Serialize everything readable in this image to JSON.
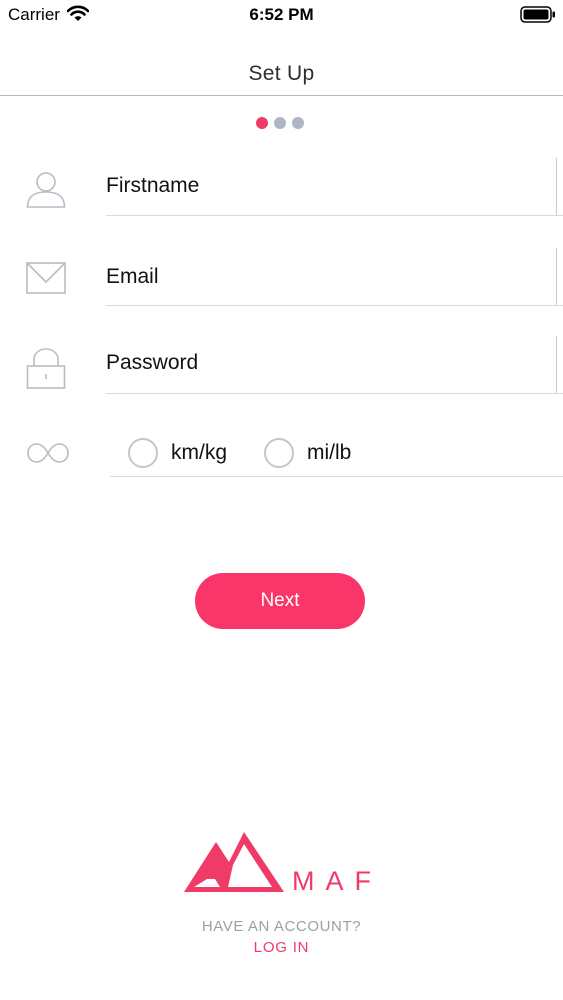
{
  "status_bar": {
    "carrier": "Carrier",
    "time": "6:52 PM"
  },
  "nav": {
    "title": "Set Up"
  },
  "pager": {
    "total": 3,
    "active_index": 0
  },
  "form": {
    "firstname": {
      "placeholder": "Firstname",
      "icon": "user-icon"
    },
    "email": {
      "placeholder": "Email",
      "icon": "envelope-icon"
    },
    "password": {
      "placeholder": "Password",
      "icon": "lock-icon"
    },
    "units": {
      "icon": "infinity-icon",
      "options": [
        "km/kg",
        "mi/lb"
      ]
    }
  },
  "next_button": {
    "label": "Next"
  },
  "footer": {
    "brand": "MAF",
    "have_account": "HAVE AN ACCOUNT?",
    "login": "LOG IN"
  },
  "colors": {
    "accent": "#f9356a",
    "inactive_dot": "#b0b5c4",
    "icon_gray": "#b8bcc4"
  }
}
